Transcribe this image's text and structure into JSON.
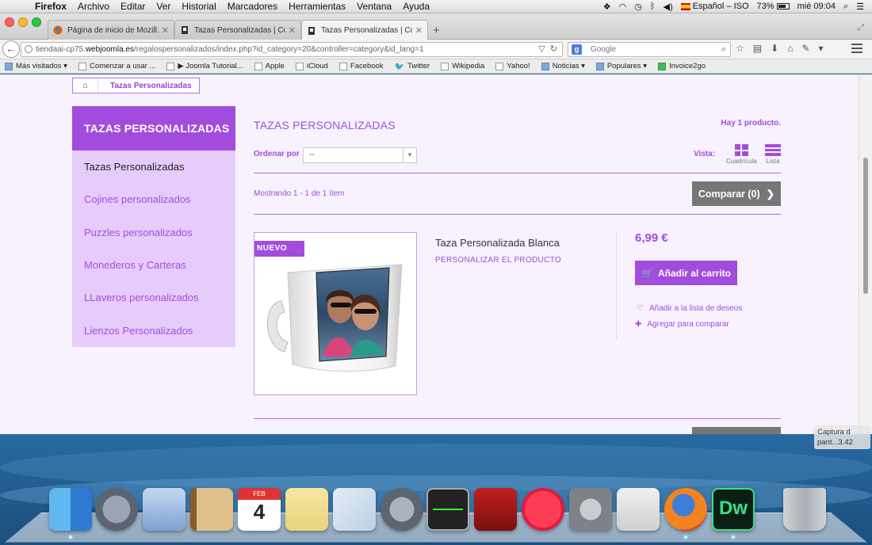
{
  "menubar": {
    "app": "Firefox",
    "items": [
      "Archivo",
      "Editar",
      "Ver",
      "Historial",
      "Marcadores",
      "Herramientas",
      "Ventana",
      "Ayuda"
    ],
    "input_source": "Español – ISO",
    "battery": "73%",
    "clock": "mié 09:04"
  },
  "tabs": [
    {
      "title": "Página de inicio de Mozill..."
    },
    {
      "title": "Tazas Personalizadas | Co..."
    },
    {
      "title": "Tazas Personalizadas | Co..."
    }
  ],
  "nav": {
    "url_prefix": "tiendaai-cp75.",
    "url_domain": "webjoomla.es",
    "url_rest": "/regalospersonalizados/index.php?id_category=20&controller=category&id_lang=1",
    "search_placeholder": "Google"
  },
  "bookmarks": [
    {
      "label": "Más visitados ▾",
      "kind": "folder"
    },
    {
      "label": "Comenzar a usar ...",
      "kind": "page"
    },
    {
      "label": "▶ Joomla Tutorial...",
      "kind": "page"
    },
    {
      "label": "Apple",
      "kind": "page"
    },
    {
      "label": "iCloud",
      "kind": "page"
    },
    {
      "label": "Facebook",
      "kind": "page"
    },
    {
      "label": "Twitter",
      "kind": "twitter"
    },
    {
      "label": "Wikipedia",
      "kind": "page"
    },
    {
      "label": "Yahoo!",
      "kind": "page"
    },
    {
      "label": "Noticias ▾",
      "kind": "folder"
    },
    {
      "label": "Populares ▾",
      "kind": "folder"
    },
    {
      "label": "Invoice2go",
      "kind": "invoice"
    }
  ],
  "breadcrumb": {
    "current": "Tazas Personalizadas"
  },
  "sidebar": {
    "title": "TAZAS PERSONALIZADAS",
    "items": [
      {
        "label": "Tazas Personalizadas",
        "current": true
      },
      {
        "label": "Cojines personalizados"
      },
      {
        "label": "Puzzles personalizados"
      },
      {
        "label": "Monederos y Carteras"
      },
      {
        "label": "LLaveros personalizados"
      },
      {
        "label": "Lienzos Personalizados"
      }
    ]
  },
  "category": {
    "title": "TAZAS PERSONALIZADAS",
    "product_count": "Hay 1 producto.",
    "sort_label": "Ordenar por",
    "sort_value": "--",
    "view_label": "Vista:",
    "view_grid": "Cuadrícula",
    "view_list": "Lista",
    "showing": "Mostrando 1 - 1 de 1 ítem",
    "compare_label": "Comparar (0)"
  },
  "product": {
    "badge": "NUEVO",
    "name": "Taza Personalizada Blanca",
    "customize": "PERSONALIZAR EL PRODUCTO",
    "price": "6,99 €",
    "add_to_cart": "Añadir al carrito",
    "wishlist": "Añadir a la lista de deseos",
    "compare": "Agregar para comparar"
  },
  "tooltip": {
    "line1": "Captura d",
    "line2": "pant...3.42"
  },
  "colors": {
    "accent": "#a24cde",
    "accent_light": "#e6ccfb",
    "page_bg": "#f7f2fd",
    "button_gray": "#777777"
  }
}
